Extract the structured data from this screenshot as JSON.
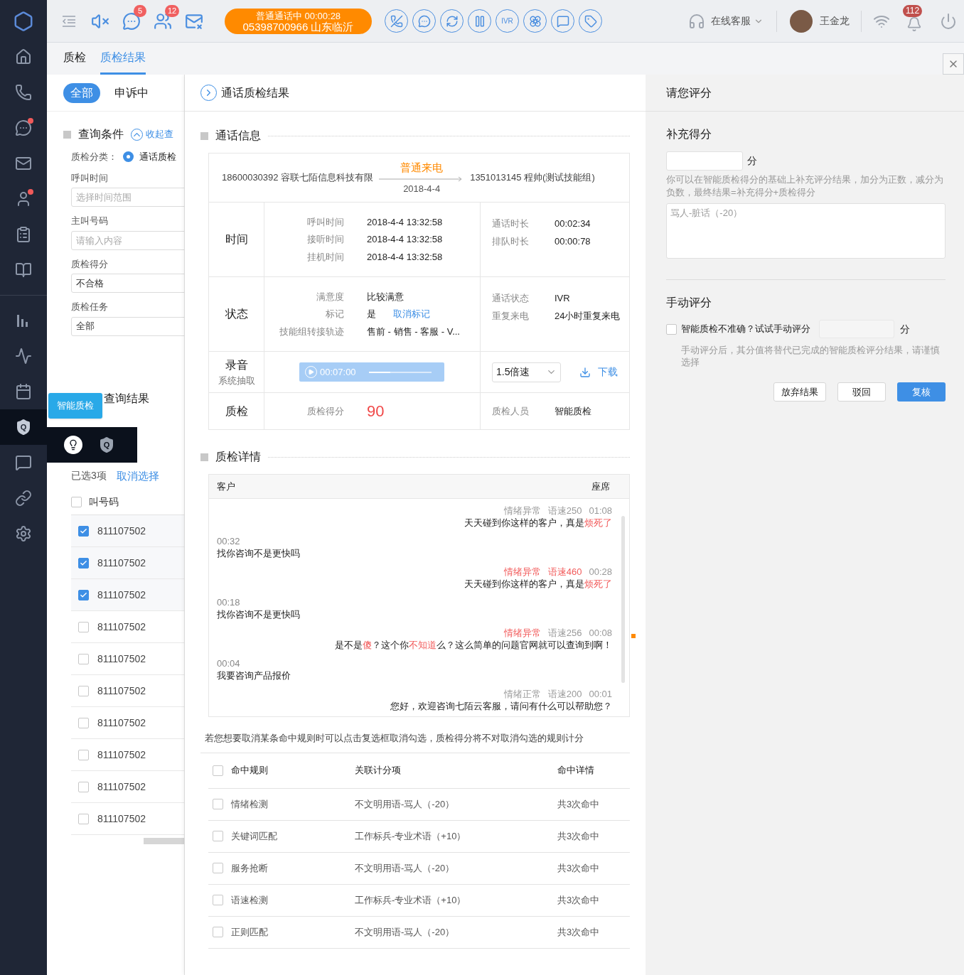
{
  "sidebar": {
    "items": [
      {
        "kind": "home",
        "selected": false,
        "dot": false
      },
      {
        "kind": "phone",
        "selected": false,
        "dot": false
      },
      {
        "kind": "chat",
        "selected": false,
        "dot": true
      },
      {
        "kind": "mail",
        "selected": false,
        "dot": false
      },
      {
        "kind": "user",
        "selected": false,
        "dot": true
      },
      {
        "kind": "clipboard",
        "selected": false,
        "dot": false
      },
      {
        "kind": "book",
        "selected": false,
        "dot": false
      },
      {
        "kind": "bars",
        "selected": false,
        "dot": false
      },
      {
        "kind": "wave",
        "selected": false,
        "dot": false
      },
      {
        "kind": "calendar",
        "selected": false,
        "dot": false
      },
      {
        "kind": "shield",
        "selected": true,
        "dot": false,
        "letter": "Q"
      },
      {
        "kind": "message",
        "selected": false,
        "dot": false
      },
      {
        "kind": "link",
        "selected": false,
        "dot": false
      },
      {
        "kind": "gear",
        "selected": false,
        "dot": false
      }
    ]
  },
  "popout": {
    "tooltip": "智能质检",
    "items": [
      {
        "kind": "bulb"
      },
      {
        "kind": "shield",
        "letter": "Q"
      }
    ]
  },
  "toolbar": {
    "tools": [
      {
        "kind": "outdent"
      },
      {
        "kind": "mute"
      },
      {
        "kind": "chat",
        "badge": "5"
      },
      {
        "kind": "users",
        "badge": "12"
      },
      {
        "kind": "mailoff"
      }
    ],
    "call": {
      "status": "普通通话中",
      "timer": "00:00:28",
      "number": "05398700966",
      "location": "山东临沂"
    },
    "actions": [
      {
        "kind": "hangup"
      },
      {
        "kind": "chat"
      },
      {
        "kind": "transfer"
      },
      {
        "kind": "pause"
      },
      {
        "kind": "text",
        "label": "IVR"
      },
      {
        "kind": "flower"
      },
      {
        "kind": "message"
      },
      {
        "kind": "tag"
      }
    ],
    "service": "在线客服",
    "user": "王金龙",
    "alerts": "112"
  },
  "tabs": [
    {
      "label": "质检",
      "selected": false
    },
    {
      "label": "质检结果",
      "selected": true
    }
  ],
  "filter_tabs": [
    {
      "label": "全部",
      "selected": true
    },
    {
      "label": "申诉中",
      "selected": false
    }
  ],
  "query": {
    "title": "查询条件",
    "collapse": "收起查",
    "category_label": "质检分类：",
    "category": {
      "label": "通话质检",
      "selected": true
    },
    "fields": [
      {
        "label": "呼叫时间",
        "placeholder": "选择时间范围"
      },
      {
        "label": "主叫号码",
        "placeholder": "请输入内容"
      },
      {
        "label": "质检得分",
        "value": "不合格"
      },
      {
        "label": "质检任务",
        "value": "全部"
      }
    ]
  },
  "results": {
    "title": "查询结果",
    "selected_count": "已选3项",
    "clear": "取消选择",
    "header": {
      "label": "叫号码",
      "checked": false
    },
    "rows": [
      {
        "number": "811107502",
        "checked": true
      },
      {
        "number": "811107502",
        "checked": true
      },
      {
        "number": "811107502",
        "checked": true
      },
      {
        "number": "811107502",
        "checked": false
      },
      {
        "number": "811107502",
        "checked": false
      },
      {
        "number": "811107502",
        "checked": false
      },
      {
        "number": "811107502",
        "checked": false
      },
      {
        "number": "811107502",
        "checked": false
      },
      {
        "number": "811107502",
        "checked": false
      },
      {
        "number": "811107502",
        "checked": false
      }
    ]
  },
  "detail": {
    "title": "通话质检结果",
    "info_title": "通话信息",
    "call": {
      "caller_number": "18600030392",
      "caller_name": "容联七陌信息科技有限",
      "type": "普通来电",
      "date": "2018-4-4",
      "callee_number": "1351013145",
      "callee_name": "程帅(测试技能组)"
    },
    "sections": [
      {
        "label": "时间",
        "left": [
          {
            "key": "呼叫时间",
            "value": "2018-4-4 13:32:58"
          },
          {
            "key": "接听时间",
            "value": "2018-4-4 13:32:58"
          },
          {
            "key": "挂机时间",
            "value": "2018-4-4 13:32:58"
          }
        ],
        "right": [
          {
            "key": "通话时长",
            "value": "00:02:34"
          },
          {
            "key": "排队时长",
            "value": "00:00:78"
          }
        ]
      },
      {
        "label": "状态",
        "left": [
          {
            "key": "满意度",
            "value": "比较满意"
          },
          {
            "key": "标记",
            "value": "是",
            "link": "取消标记"
          },
          {
            "key": "技能组转接轨迹",
            "value": "售前 - 销售 - 客服 - V..."
          }
        ],
        "right": [
          {
            "key": "通话状态",
            "value": "IVR"
          },
          {
            "key": "重复来电",
            "value": "24小时重复来电"
          }
        ]
      }
    ],
    "recording": {
      "label": "录音",
      "sublabel": "系统抽取",
      "time": "00:07:00",
      "level": 0.35,
      "speed": "1.5倍速",
      "download": "下载"
    },
    "quality": {
      "label": "质检",
      "score_label": "质检得分",
      "score": "90",
      "inspector_label": "质检人员",
      "inspector": "智能质检"
    },
    "detail_title": "质检详情",
    "customer_col": "客户",
    "agent_col": "座席",
    "messages": [
      {
        "kind": "agent",
        "tags": [
          {
            "text": "情绪异常",
            "flagged": false
          },
          {
            "text": "语速250",
            "flagged": false
          }
        ],
        "time": "01:08",
        "segments": [
          {
            "text": "天天碰到你这样的客户，真是",
            "flagged": false
          },
          {
            "text": "烦死了",
            "flagged": true
          }
        ]
      },
      {
        "kind": "customer",
        "time": "00:32",
        "segments": [
          {
            "text": "找你咨询不是更快吗",
            "flagged": false
          }
        ]
      },
      {
        "kind": "agent",
        "tags": [
          {
            "text": "情绪异常",
            "flagged": true
          },
          {
            "text": "语速460",
            "flagged": true
          }
        ],
        "time": "00:28",
        "segments": [
          {
            "text": "天天碰到你这样的客户，真是",
            "flagged": false
          },
          {
            "text": "烦死了",
            "flagged": true
          }
        ]
      },
      {
        "kind": "customer",
        "time": "00:18",
        "segments": [
          {
            "text": "找你咨询不是更快吗",
            "flagged": false
          }
        ]
      },
      {
        "kind": "agent",
        "tags": [
          {
            "text": "情绪异常",
            "flagged": true
          },
          {
            "text": "语速256",
            "flagged": false
          }
        ],
        "time": "00:08",
        "segments": [
          {
            "text": "是不是",
            "flagged": false
          },
          {
            "text": "傻",
            "flagged": true
          },
          {
            "text": "？这个你",
            "flagged": false
          },
          {
            "text": "不知道",
            "flagged": true
          },
          {
            "text": "么？这么简单的问题官网就可以查询到啊！",
            "flagged": false
          }
        ]
      },
      {
        "kind": "customer",
        "time": "00:04",
        "segments": [
          {
            "text": "我要咨询产品报价",
            "flagged": false
          }
        ]
      },
      {
        "kind": "agent",
        "tags": [
          {
            "text": "情绪正常",
            "flagged": false
          },
          {
            "text": "语速200",
            "flagged": false
          }
        ],
        "time": "00:01",
        "segments": [
          {
            "text": "您好，欢迎咨询七陌云客服，请问有什么可以帮助您？",
            "flagged": false
          }
        ]
      }
    ],
    "rules_note": "若您想要取消某条命中规则时可以点击复选框取消勾选，质检得分将不对取消勾选的规则计分",
    "rules_columns": [
      "命中规则",
      "关联计分项",
      "命中详情"
    ],
    "rules_all_checked": false,
    "rules": [
      {
        "checked": false,
        "rule": "情绪检测",
        "item": "不文明用语-骂人（-20）",
        "detail": "共3次命中"
      },
      {
        "checked": false,
        "rule": "关键词匹配",
        "item": "工作标兵-专业术语（+10）",
        "detail": "共3次命中"
      },
      {
        "checked": false,
        "rule": "服务抢断",
        "item": "不文明用语-骂人（-20）",
        "detail": "共3次命中"
      },
      {
        "checked": false,
        "rule": "语速检测",
        "item": "工作标兵-专业术语（+10）",
        "detail": "共3次命中"
      },
      {
        "checked": false,
        "rule": "正则匹配",
        "item": "不文明用语-骂人（-20）",
        "detail": "共3次命中"
      }
    ]
  },
  "rating": {
    "title": "请您评分",
    "extra_title": "补充得分",
    "unit": "分",
    "extra_hint": "你可以在智能质检得分的基础上补充评分结果，加分为正数，减分为负数，最终结果=补充得分+质检得分",
    "comment_placeholder": "骂人-脏话（-20）",
    "manual_title": "手动评分",
    "manual_label": "智能质检不准确？试试手动评分",
    "manual_checked": false,
    "manual_unit": "分",
    "manual_hint": "手动评分后，其分值将替代已完成的智能质检评分结果，请谨慎选择",
    "buttons": [
      {
        "label": "放弃结果",
        "kind": "plain"
      },
      {
        "label": "驳回",
        "kind": "plain"
      },
      {
        "label": "复核",
        "kind": "primary"
      }
    ]
  }
}
